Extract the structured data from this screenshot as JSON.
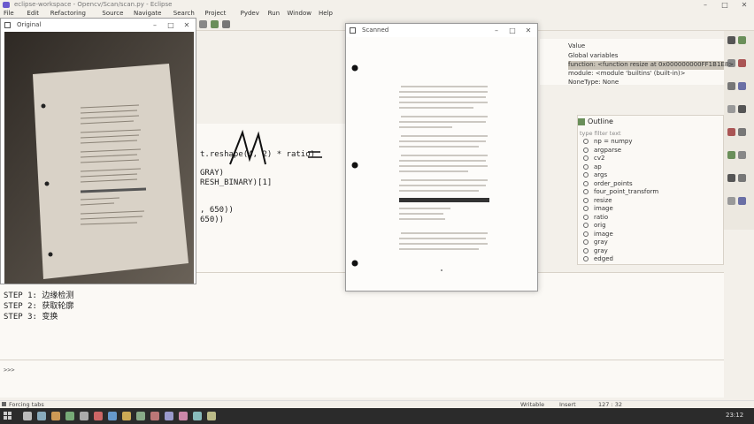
{
  "app": {
    "title": "eclipse-workspace - Opencv/Scan/scan.py - Eclipse",
    "menu": [
      "File",
      "Edit",
      "Refactoring",
      "Source",
      "Navigate",
      "Search",
      "Project",
      "Pydev",
      "Run",
      "Window",
      "Help"
    ]
  },
  "windows": {
    "original": {
      "title": "Original"
    },
    "scanned": {
      "title": "Scanned"
    }
  },
  "editor": {
    "lines": [
      "t.reshape(4, 2) * ratio)",
      "",
      "GRAY)",
      "RESH_BINARY)[1]",
      "",
      "",
      ", 650))",
      "650))"
    ],
    "annotation": "= "
  },
  "console": {
    "steps": [
      "STEP 1: 边缘检测",
      "STEP 2: 获取轮廓",
      "STEP 3: 变换"
    ],
    "prompt": ">>>"
  },
  "variables": {
    "header": "Value",
    "rows": [
      "Global variables",
      "function: <function resize at 0x000000000FF1B1E8>",
      "module: <module 'builtins' (built-in)>",
      "NoneType: None"
    ]
  },
  "outline": {
    "title": "Outline",
    "filter_placeholder": "type filter text",
    "items": [
      "np = numpy",
      "argparse",
      "cv2",
      "ap",
      "args",
      "order_points",
      "four_point_transform",
      "resize",
      "image",
      "ratio",
      "orig",
      "image",
      "gray",
      "gray",
      "edged"
    ]
  },
  "statusbar": {
    "left": "Forcing tabs",
    "writable": "Writable",
    "insert": "Insert",
    "position": "127 : 32"
  },
  "taskbar": {
    "time": "23:12"
  }
}
